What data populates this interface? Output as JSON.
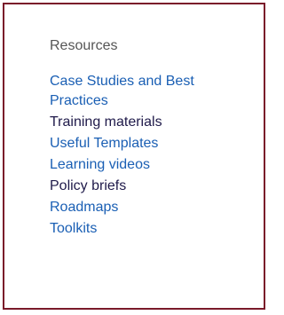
{
  "panel": {
    "heading": "Resources",
    "items": [
      {
        "label": "Case Studies and Best Practices",
        "color": "#1a5fb4"
      },
      {
        "label": "Training materials",
        "color": "#1f1a4a"
      },
      {
        "label": "Useful Templates",
        "color": "#1a5fb4"
      },
      {
        "label": "Learning videos",
        "color": "#1a5fb4"
      },
      {
        "label": "Policy briefs",
        "color": "#1f1a4a"
      },
      {
        "label": "Roadmaps",
        "color": "#1a5fb4"
      },
      {
        "label": "Toolkits",
        "color": "#1a5fb4"
      }
    ]
  },
  "colors": {
    "border": "#7a1a2a",
    "heading": "#555555",
    "link": "#1a5fb4",
    "visited_link": "#1f1a4a"
  }
}
